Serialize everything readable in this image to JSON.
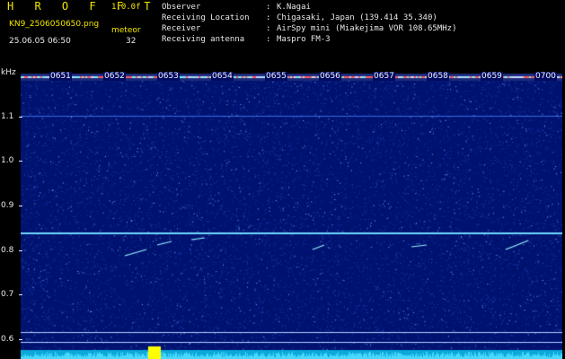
{
  "header": {
    "app_logo": "H R O F F T",
    "app_version": "1.0.0f",
    "file_name": "KN9_2506050650.png",
    "meteor_label": "meteor",
    "datetime": "25.06.05 06:50",
    "meteor_count": "32"
  },
  "info": [
    {
      "label": "Observer",
      "sep": ":",
      "value": "K.Nagai"
    },
    {
      "label": "Receiving Location",
      "sep": ":",
      "value": "Chigasaki, Japan (139.414 35.340)"
    },
    {
      "label": "Receiver",
      "sep": ":",
      "value": "AirSpy mini (Miakejima VOR 108.65MHz)"
    },
    {
      "label": "Receiving antenna",
      "sep": ":",
      "value": "Maspro FM-3"
    }
  ],
  "axis": {
    "unit": "kHz",
    "ticks": [
      "1.1",
      "1.0",
      "0.9",
      "0.8",
      "0.7",
      "0.6"
    ]
  },
  "time_labels": [
    "0651",
    "0652",
    "0653",
    "0654",
    "0655",
    "0656",
    "0657",
    "0658",
    "0659",
    "0700"
  ],
  "colors": {
    "background": "#000000",
    "spectrogram_base": "#001270",
    "title_yellow": "#f2e600",
    "text_white": "#e8e8e8",
    "signal_cyan": "#9af2ff",
    "noise_yellow": "#ffff00"
  }
}
